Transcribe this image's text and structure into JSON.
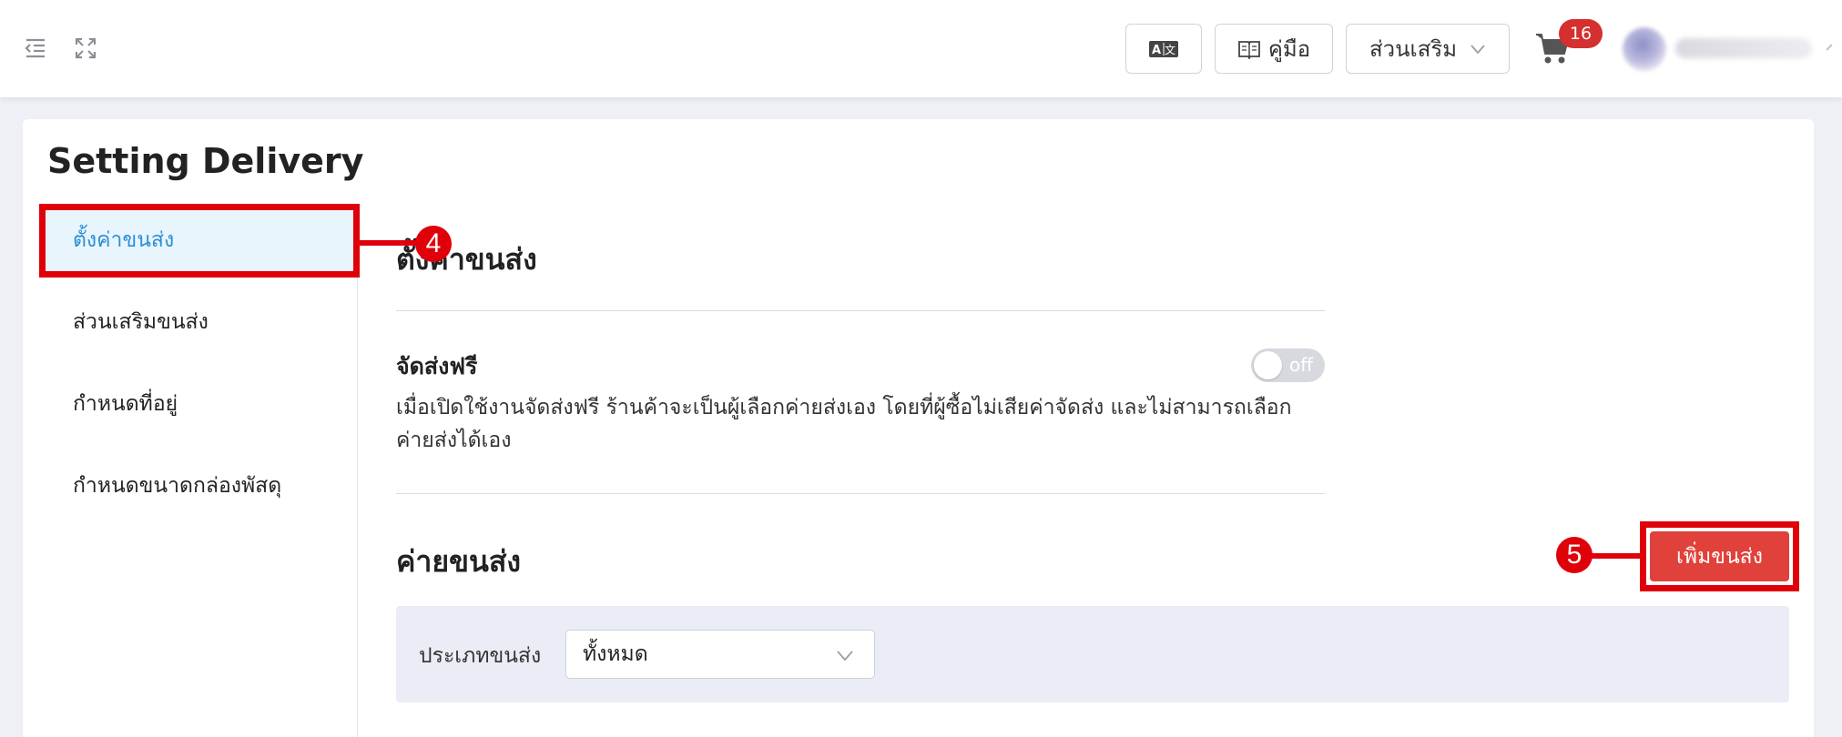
{
  "header": {
    "translate_icon": "translate-icon",
    "manual_label": "คู่มือ",
    "addons_label": "ส่วนเสริม",
    "cart_count": "16"
  },
  "page": {
    "title": "Setting Delivery"
  },
  "sidebar": {
    "items": [
      {
        "label": "ตั้งค่าขนส่ง",
        "active": true
      },
      {
        "label": "ส่วนเสริมขนส่ง"
      },
      {
        "label": "กำหนดที่อยู่"
      },
      {
        "label": "กำหนดขนาดกล่องพัสดุ"
      }
    ]
  },
  "main": {
    "section_title": "ตั้งค่าขนส่ง",
    "free_shipping": {
      "title": "จัดส่งฟรี",
      "toggle_label": "off",
      "description": "เมื่อเปิดใช้งานจัดส่งฟรี ร้านค้าจะเป็นผู้เลือกค่ายส่งเอง โดยที่ผู้ซื้อไม่เสียค่าจัดส่ง และไม่สามารถเลือกค่ายส่งได้เอง"
    },
    "carriers_title": "ค่ายขนส่ง",
    "add_button": "เพิ่มขนส่ง",
    "filter": {
      "label": "ประเภทขนส่ง",
      "value": "ทั้งหมด"
    }
  },
  "annotations": {
    "step4": "4",
    "step5": "5"
  },
  "colors": {
    "accent_red": "#e0413a",
    "active_blue": "#2b8fd6",
    "annotation_red": "#e0000a"
  }
}
